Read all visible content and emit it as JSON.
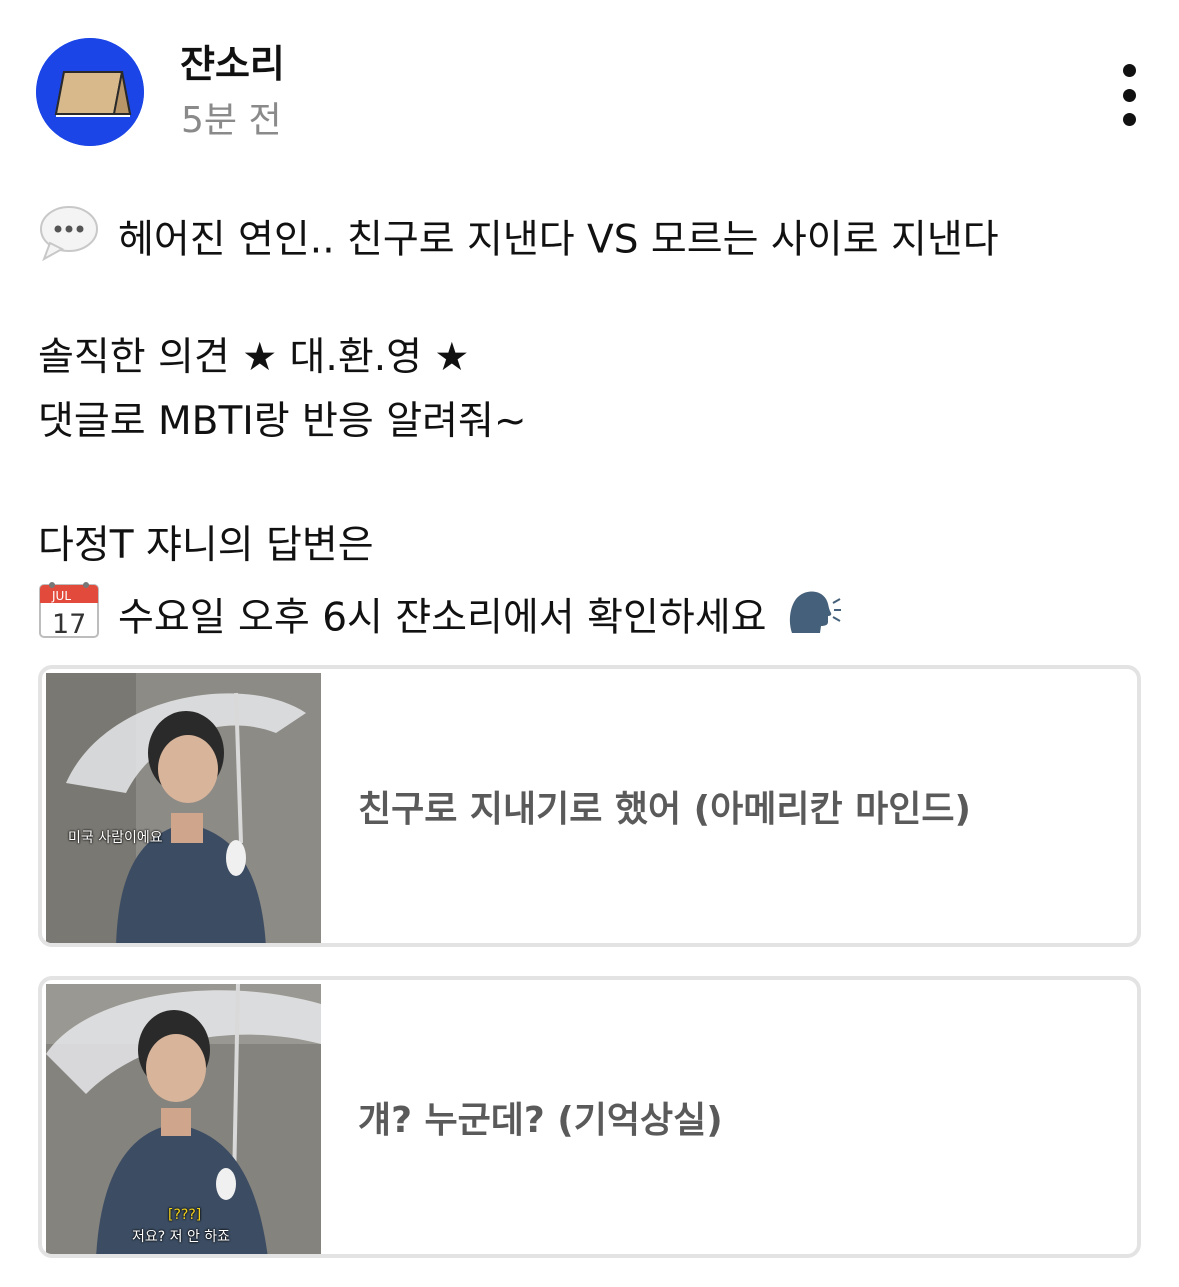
{
  "author": {
    "name": "쟌소리",
    "time": "5분 전"
  },
  "post": {
    "line1": "헤어진 연인.. 친구로 지낸다 VS 모르는 사이로 지낸다",
    "line2": "솔직한 의견 ★ 대.환.영 ★",
    "line3": "댓글로 MBTI랑 반응 알려줘~",
    "line4": "다정T 쟈니의 답변은",
    "line5": "수요일 오후 6시 쟌소리에서 확인하세요",
    "calendar_month": "JUL",
    "calendar_day": "17"
  },
  "icons": {
    "speech_bubble": "speech-bubble-icon",
    "calendar": "calendar-icon",
    "speaking_head": "speaking-head-icon",
    "more": "more-vertical-icon"
  },
  "poll": {
    "options": [
      {
        "label": "친구로 지내기로 했어 (아메리칸 마인드)",
        "thumb_caption": "미국 사람이에요"
      },
      {
        "label": "걔? 누군데? (기억상실)",
        "thumb_caption_tag": "[???]",
        "thumb_caption": "저요? 저 안 하죠"
      }
    ]
  },
  "colors": {
    "avatar_bg": "#1b45e6",
    "option_border": "#e3e3e3",
    "option_text": "#5a5a5a",
    "time_text": "#8a8a8a"
  }
}
